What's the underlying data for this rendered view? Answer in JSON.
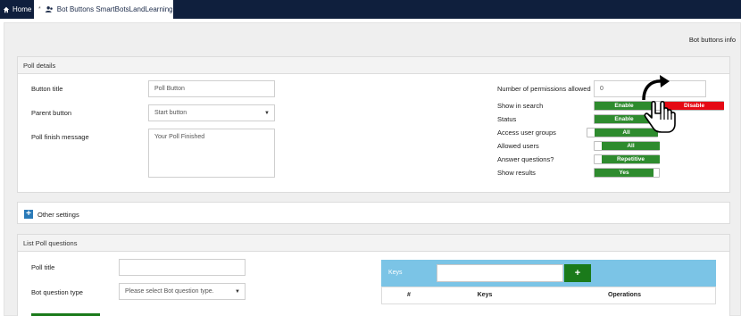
{
  "tabs": {
    "home": "Home",
    "bot": "Bot Buttons SmartBotsLandLearning"
  },
  "header": {
    "info_link": "Bot buttons info"
  },
  "poll_details": {
    "title": "Poll details",
    "button_title": {
      "label": "Button title",
      "value": "Poll Button"
    },
    "parent_button": {
      "label": "Parent button",
      "value": "Start button"
    },
    "finish_message": {
      "label": "Poll finish message",
      "value": "Your Poll Finished"
    },
    "permissions": {
      "label": "Number of permissions allowed",
      "value": "0"
    },
    "show_in_search": {
      "label": "Show in search",
      "on": "Enable",
      "off": "Disable"
    },
    "status": {
      "label": "Status",
      "on": "Enable"
    },
    "access_groups": {
      "label": "Access user groups",
      "on": "All"
    },
    "allowed_users": {
      "label": "Allowed users",
      "on": "All"
    },
    "answer_questions": {
      "label": "Answer questions?",
      "on": "Repetitive"
    },
    "show_results": {
      "label": "Show results",
      "on": "Yes"
    }
  },
  "other_settings": {
    "title": "Other settings"
  },
  "list_questions": {
    "title": "List Poll questions",
    "poll_title": {
      "label": "Poll title",
      "value": ""
    },
    "question_type": {
      "label": "Bot question type",
      "placeholder": "Please select Bot question type."
    },
    "keys": {
      "label": "Keys",
      "add": "+",
      "columns": [
        "#",
        "Keys",
        "Operations"
      ]
    }
  },
  "colors": {
    "topbar": "#0f1f3d",
    "enable": "#2e8b2e",
    "disable": "#e50914",
    "keys_bar": "#7bc4e6"
  }
}
